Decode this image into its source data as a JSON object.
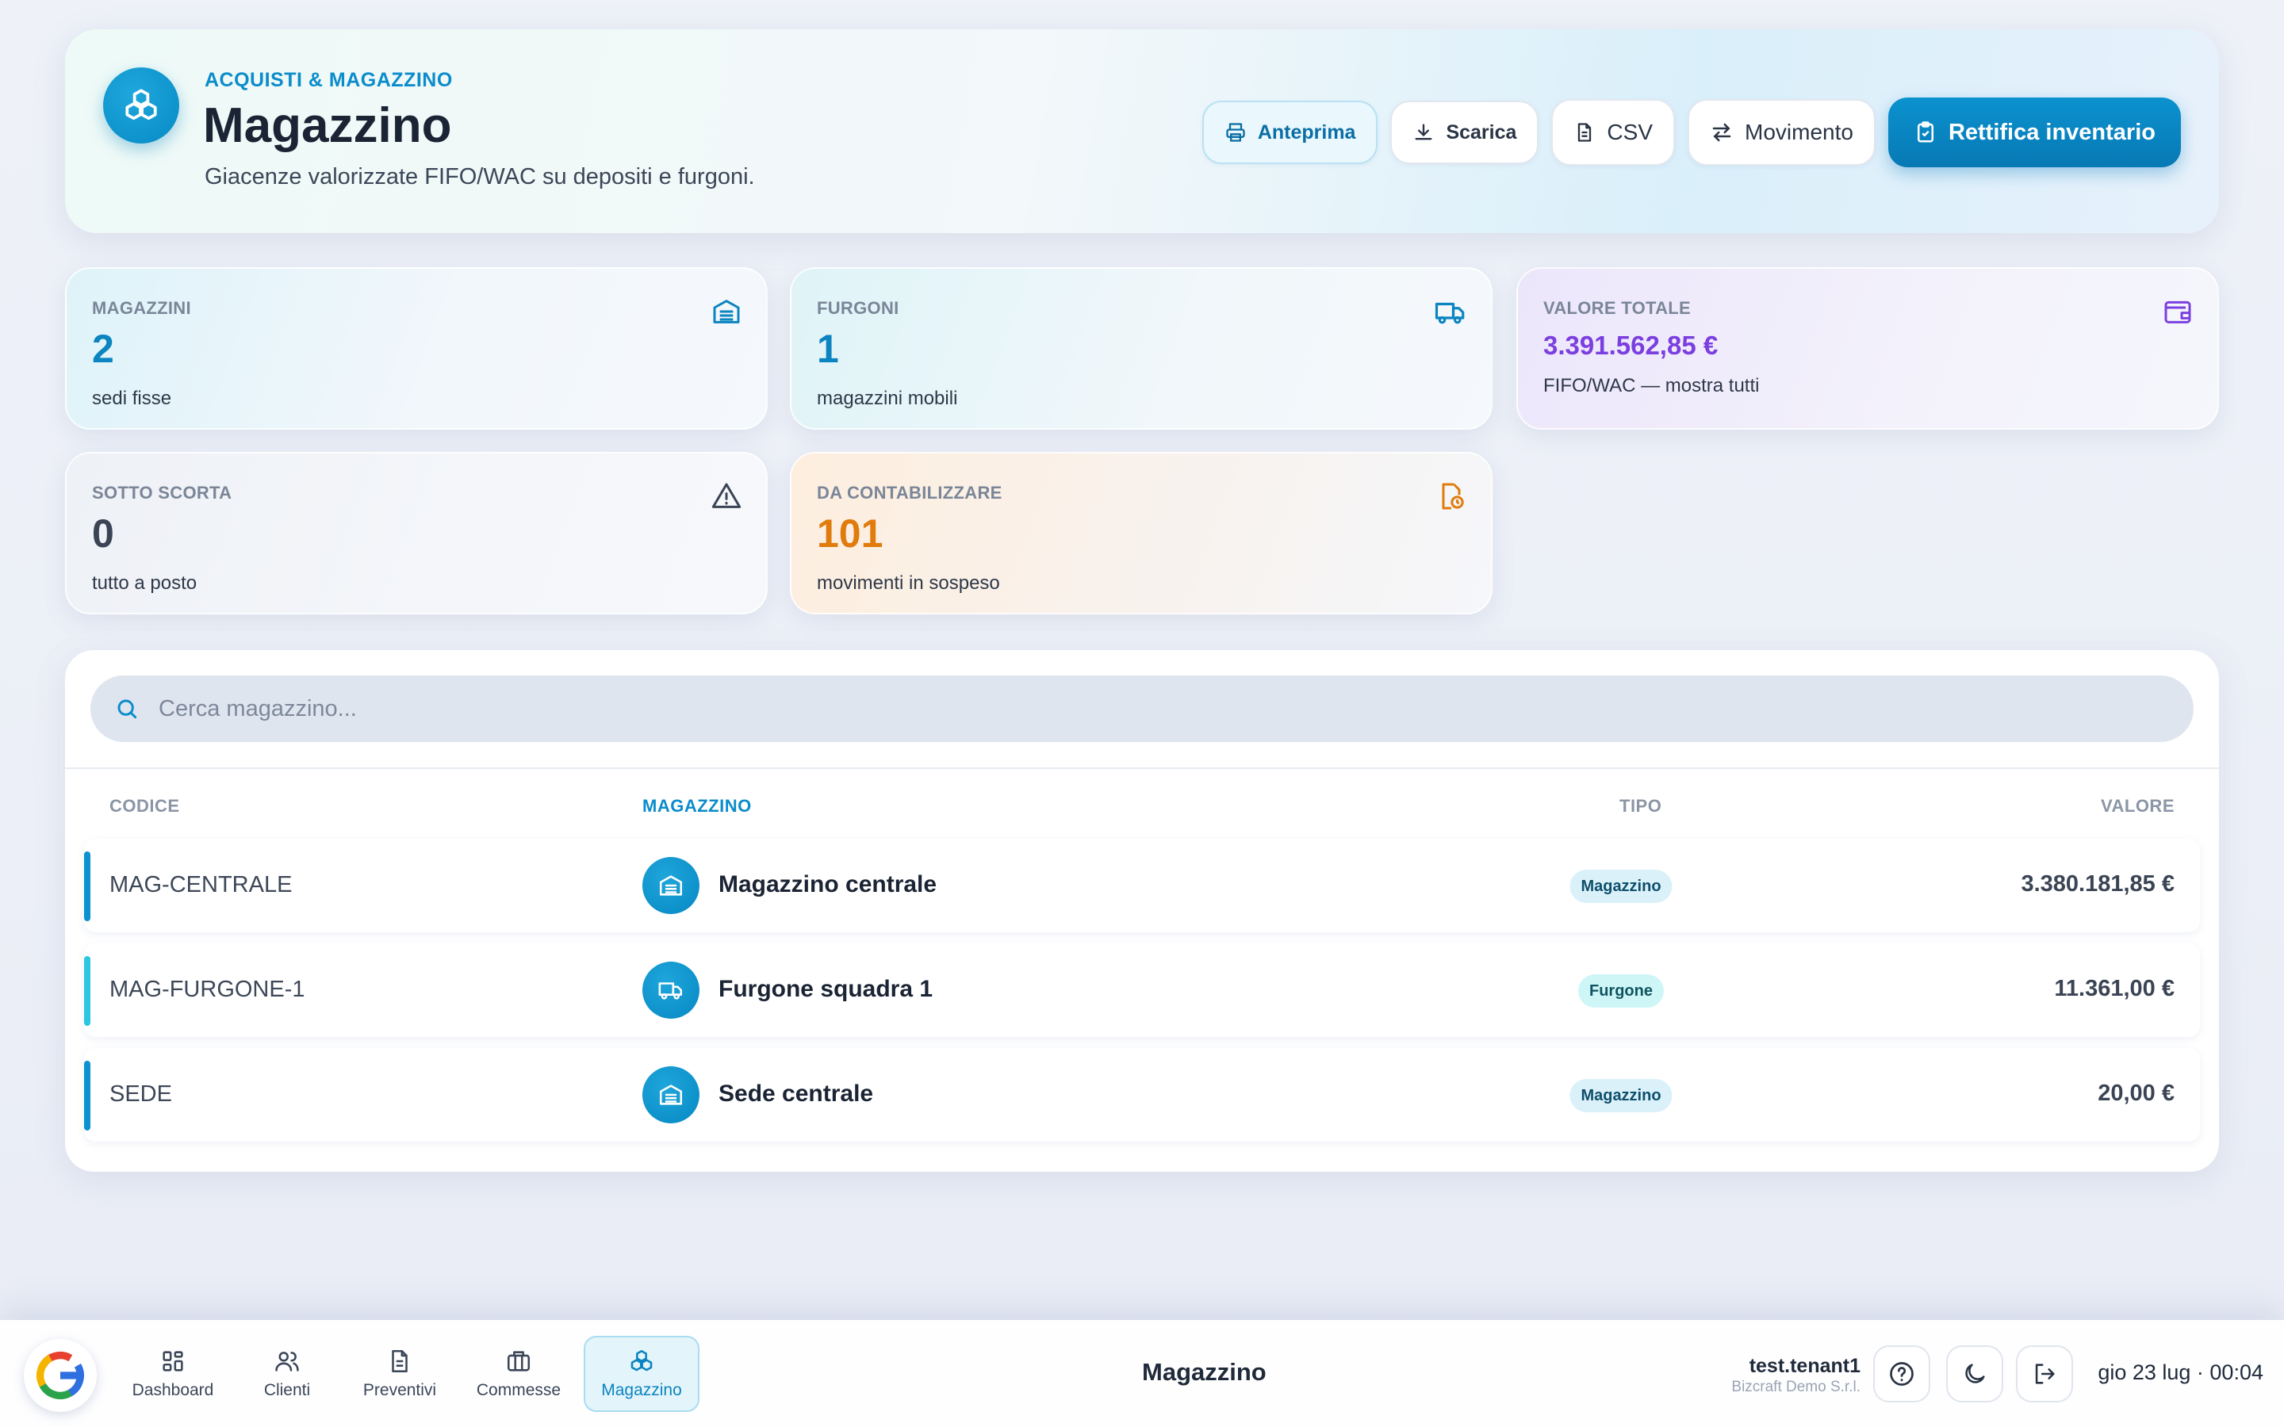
{
  "header": {
    "eyebrow": "ACQUISTI & MAGAZZINO",
    "title": "Magazzino",
    "subtitle": "Giacenze valorizzate FIFO/WAC su depositi e furgoni.",
    "actions": {
      "preview": "Anteprima",
      "download": "Scarica",
      "csv": "CSV",
      "movement": "Movimento",
      "adjust": "Rettifica inventario"
    }
  },
  "kpis": {
    "warehouses": {
      "label": "MAGAZZINI",
      "value": "2",
      "sub": "sedi fisse",
      "color": "#0b84c0",
      "icon": "warehouse-icon"
    },
    "vans": {
      "label": "FURGONI",
      "value": "1",
      "sub": "magazzini mobili",
      "color": "#0b84c0",
      "icon": "truck-icon"
    },
    "total_value": {
      "label": "VALORE TOTALE",
      "value": "3.391.562,85 €",
      "sub": "FIFO/WAC — mostra tutti",
      "color": "#7b3fe0",
      "icon": "wallet-icon"
    },
    "under_stock": {
      "label": "SOTTO SCORTA",
      "value": "0",
      "sub": "tutto a posto",
      "color": "#3a4454",
      "icon": "warning-icon"
    },
    "to_account": {
      "label": "DA CONTABILIZZARE",
      "value": "101",
      "sub": "movimenti in sospeso",
      "color": "#e07b0c",
      "icon": "file-clock-icon"
    }
  },
  "search": {
    "placeholder": "Cerca magazzino..."
  },
  "table": {
    "columns": {
      "code": "CODICE",
      "warehouse": "MAGAZZINO",
      "type": "TIPO",
      "value": "VALORE"
    },
    "rows": [
      {
        "code": "MAG-CENTRALE",
        "name": "Magazzino centrale",
        "type": "Magazzino",
        "value": "3.380.181,85 €",
        "accent": "#0b92cf",
        "icon": "warehouse-icon"
      },
      {
        "code": "MAG-FURGONE-1",
        "name": "Furgone squadra 1",
        "type": "Furgone",
        "value": "11.361,00 €",
        "accent": "#2cc6e0",
        "icon": "truck-icon"
      },
      {
        "code": "SEDE",
        "name": "Sede centrale",
        "type": "Magazzino",
        "value": "20,00 €",
        "accent": "#0b92cf",
        "icon": "warehouse-icon"
      }
    ]
  },
  "dock": {
    "nav": {
      "dashboard": "Dashboard",
      "clients": "Clienti",
      "quotes": "Preventivi",
      "jobs": "Commesse",
      "warehouse": "Magazzino"
    },
    "current_page": "Magazzino",
    "user": "test.tenant1",
    "organization": "Bizcraft Demo S.r.l.",
    "datetime": "gio 23 lug · 00:04"
  }
}
